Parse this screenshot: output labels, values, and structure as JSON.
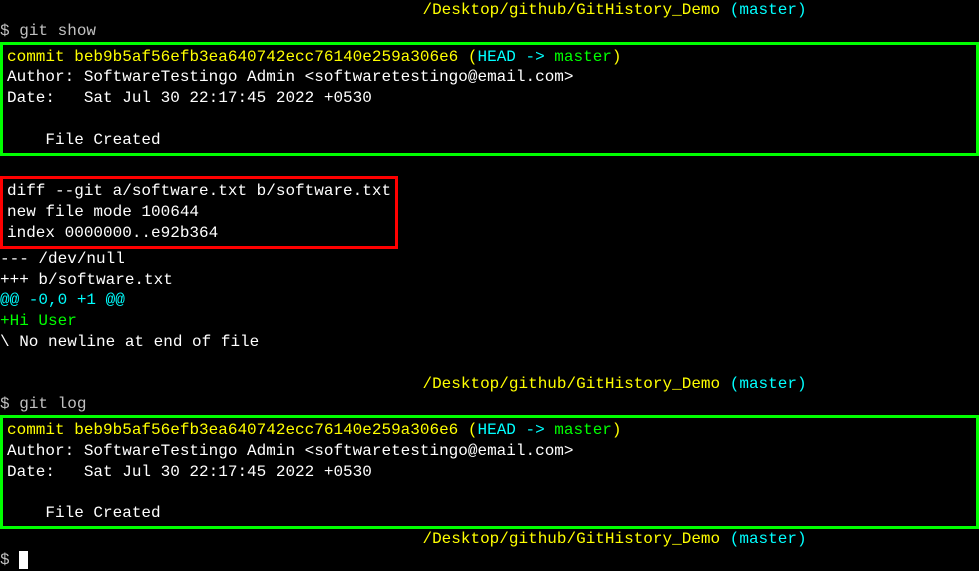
{
  "prompt": {
    "hidden_user": "                                            ",
    "path": "/Desktop/github/GitHistory_Demo",
    "branch": "master",
    "dollar": "$"
  },
  "commands": {
    "git_show": "git show",
    "git_log": "git log"
  },
  "commit": {
    "label": "commit ",
    "hash": "beb9b5af56efb3ea640742ecc76140e259a306e6",
    "open_paren": " (",
    "head": "HEAD -> ",
    "master": "master",
    "close_paren": ")"
  },
  "author_line": "Author: SoftwareTestingo Admin <softwaretestingo@email.com>",
  "date_line": "Date:   Sat Jul 30 22:17:45 2022 +0530",
  "message": "    File Created",
  "diff": {
    "header": "diff --git a/software.txt b/software.txt",
    "mode": "new file mode 100644",
    "index": "index 0000000..e92b364",
    "from": "--- /dev/null",
    "to": "+++ b/software.txt",
    "hunk": "@@ -0,0 +1 @@",
    "add": "+Hi User",
    "noeol": "\\ No newline at end of file"
  }
}
